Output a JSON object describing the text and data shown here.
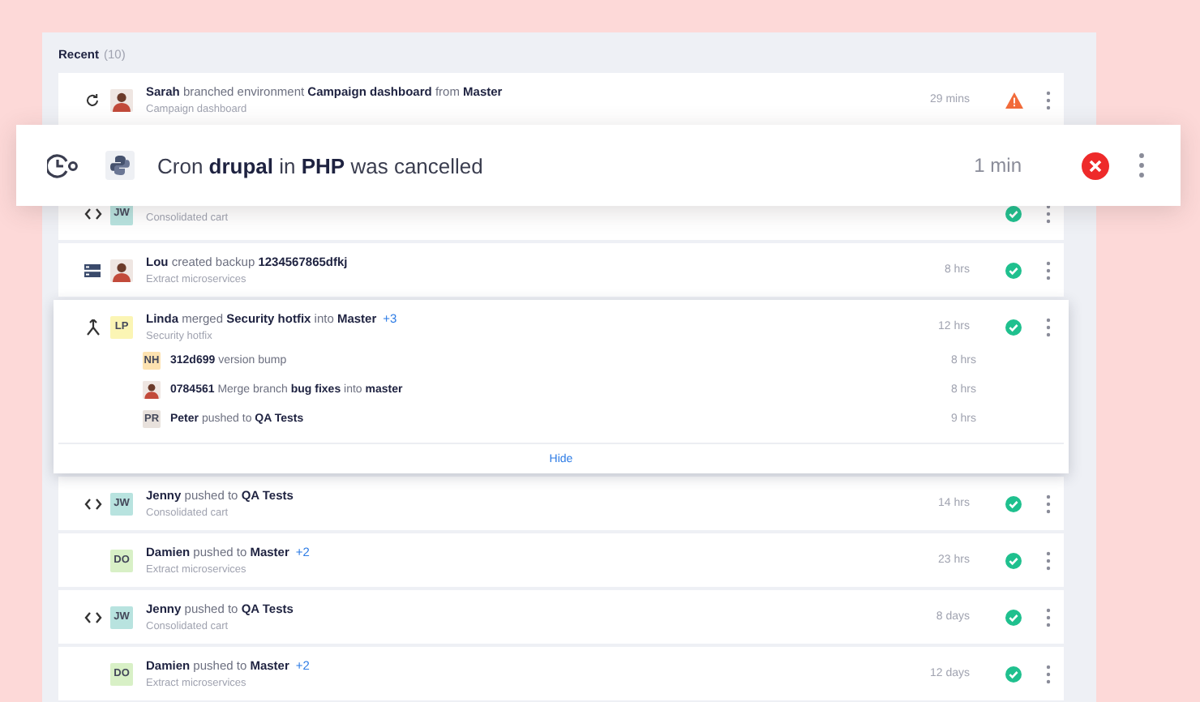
{
  "panel": {
    "title": "Recent",
    "count": "(10)"
  },
  "toast": {
    "text": "Cron **drupal** in **PHP** was cancelled",
    "time": "1 min",
    "status": {
      "kind": "error"
    }
  },
  "activities": [
    {
      "kind": "refresh",
      "avatar": {
        "kind": "photo"
      },
      "title": "**Sarah** branched environment **Campaign dashboard** from **Master**",
      "subtitle": "Campaign dashboard",
      "time": "29 mins",
      "status": {
        "kind": "warning"
      }
    },
    {
      "kind": "code",
      "avatar": {
        "kind": "initials",
        "initials": "JW",
        "color": "#b8e3df"
      },
      "subtitle": "Consolidated cart",
      "status": {
        "kind": "success"
      }
    },
    {
      "kind": "backup",
      "avatar": {
        "kind": "photo"
      },
      "title": "**Lou** created backup **1234567865dfkj**",
      "subtitle": "Extract microservices",
      "time": "8 hrs",
      "status": {
        "kind": "success"
      }
    },
    {
      "kind": "merge",
      "avatar": {
        "kind": "initials",
        "initials": "LP",
        "color": "#fbf5b4"
      },
      "title": "**Linda** merged **Security hotfix** into **Master**",
      "extra": "+3",
      "subtitle": "Security hotfix",
      "time": "12 hrs",
      "status": {
        "kind": "success"
      },
      "expanded": true,
      "toggle": "Hide",
      "children": [
        {
          "avatar": {
            "kind": "initials",
            "initials": "NH",
            "color": "#fde2b0"
          },
          "text": "**312d699** version bump",
          "time": "8 hrs"
        },
        {
          "avatar": {
            "kind": "photo"
          },
          "text": "**0784561** Merge branch **bug fixes** into **master**",
          "time": "8 hrs"
        },
        {
          "avatar": {
            "kind": "initials",
            "initials": "PR",
            "color": "#e8e1dc"
          },
          "text": "**Peter** pushed to **QA Tests**",
          "time": "9 hrs"
        }
      ]
    },
    {
      "kind": "code",
      "avatar": {
        "kind": "initials",
        "initials": "JW",
        "color": "#b8e3df"
      },
      "title": "**Jenny** pushed to **QA Tests**",
      "subtitle": "Consolidated cart",
      "time": "14 hrs",
      "status": {
        "kind": "success"
      }
    },
    {
      "kind": "none",
      "avatar": {
        "kind": "initials",
        "initials": "DO",
        "color": "#d8f0c6"
      },
      "title": "**Damien** pushed to **Master**",
      "extra": "+2",
      "subtitle": "Extract microservices",
      "time": "23 hrs",
      "status": {
        "kind": "success"
      }
    },
    {
      "kind": "code",
      "avatar": {
        "kind": "initials",
        "initials": "JW",
        "color": "#b8e3df"
      },
      "title": "**Jenny** pushed to **QA Tests**",
      "subtitle": "Consolidated cart",
      "time": "8 days",
      "status": {
        "kind": "success"
      }
    },
    {
      "kind": "none",
      "avatar": {
        "kind": "initials",
        "initials": "DO",
        "color": "#d8f0c6"
      },
      "title": "**Damien** pushed to **Master**",
      "extra": "+2",
      "subtitle": "Extract microservices",
      "time": "12 days",
      "status": {
        "kind": "success"
      }
    }
  ]
}
